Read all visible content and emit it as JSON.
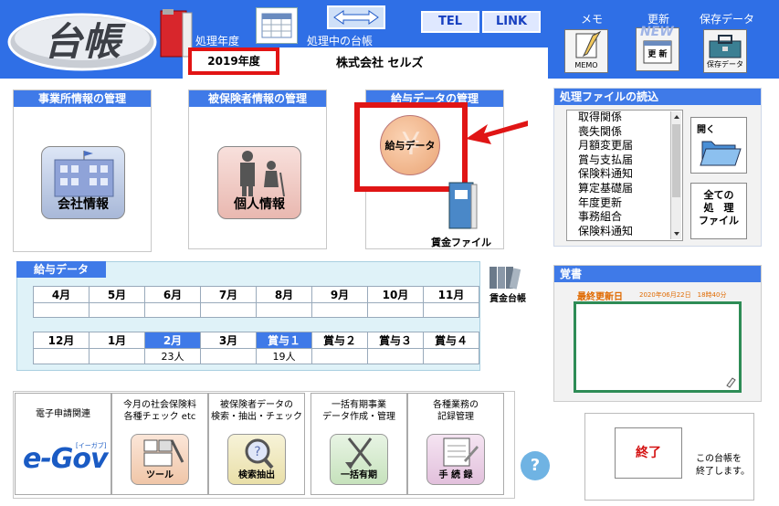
{
  "header": {
    "logo_text": "台帳",
    "year_caption": "処理年度",
    "current_book_caption": "処理中の台帳",
    "year_value": "2019年度",
    "company_name": "株式会社 セルズ",
    "tel_label": "TEL",
    "link_label": "LINK",
    "memo_top_label": "メモ",
    "memo_btn_label": "MEMO",
    "new_top_label": "更新",
    "new_badge": "NEW",
    "new_btn_label": "更 新",
    "save_top_label": "保存データ",
    "save_btn_label": "保存データ"
  },
  "panels": {
    "office_title": "事業所情報の管理",
    "office_button": "会社情報",
    "insured_title": "被保険者情報の管理",
    "insured_button": "個人情報",
    "salary_title": "給与データの管理",
    "salary_button": "給与データ",
    "wage_file_label": "賃金ファイル"
  },
  "files": {
    "title": "処理ファイルの読込",
    "items": [
      "取得関係",
      "喪失関係",
      "月額変更届",
      "賞与支払届",
      "保険料通知",
      "算定基礎届",
      "年度更新",
      "事務組合",
      "保険料通知"
    ],
    "open_label": "開く",
    "all_files_label": [
      "全ての",
      "処　理",
      "ファイル"
    ]
  },
  "salary_grid": {
    "tab_title": "給与データ",
    "row1_headers": [
      "4月",
      "5月",
      "6月",
      "7月",
      "8月",
      "9月",
      "10月",
      "11月"
    ],
    "row1_values": [
      "",
      "",
      "",
      "",
      "",
      "",
      "",
      ""
    ],
    "row2_headers": [
      "12月",
      "1月",
      "2月",
      "3月",
      "賞与１",
      "賞与２",
      "賞与３",
      "賞与４"
    ],
    "row2_values": [
      "",
      "",
      "23人",
      "",
      "19人",
      "",
      "",
      ""
    ],
    "highlighted": [
      2,
      4
    ],
    "ledger_label": "賃金台帳"
  },
  "memo": {
    "title": "覚書",
    "last_updated_label": "最終更新日",
    "last_updated_value": "2020年06月22日　18時40分"
  },
  "tools": [
    {
      "title": [
        "電子申請関連"
      ],
      "caption": "e-Gov",
      "sub": "[イーガブ]"
    },
    {
      "title": [
        "今月の社会保険料",
        "各種チェック etc"
      ],
      "caption": "ツール"
    },
    {
      "title": [
        "被保険者データの",
        "検索・抽出・チェック"
      ],
      "caption": "検索抽出"
    },
    {
      "title": [
        "一括有期事業",
        "データ作成・管理"
      ],
      "caption": "一括有期"
    },
    {
      "title": [
        "各種業務の",
        "記録管理"
      ],
      "caption": "手 続 録"
    }
  ],
  "help_label": "?",
  "exit": {
    "label": "終了",
    "note": [
      "この台帳を",
      "終了します。"
    ]
  },
  "colors": {
    "header_blue": "#2f6fe6",
    "highlight_red": "#e01515",
    "memo_green": "#2e8c56"
  }
}
